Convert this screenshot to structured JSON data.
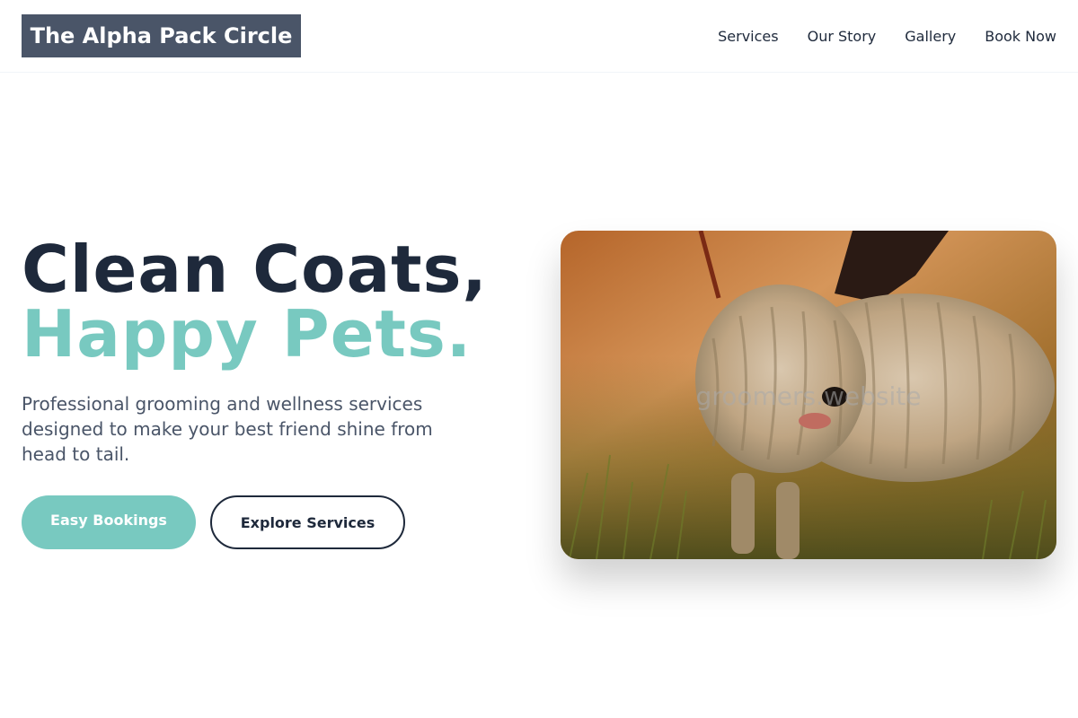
{
  "header": {
    "logo_text": "The Alpha Pack Circle",
    "nav": [
      "Services",
      "Our Story",
      "Gallery",
      "Book Now"
    ]
  },
  "hero": {
    "title_line1": "Clean Coats,",
    "title_line2": "Happy Pets.",
    "description": "Professional grooming and wellness services designed to make your best friend shine from head to tail.",
    "primary_button": "Easy Bookings",
    "secondary_button": "Explore Services",
    "image_watermark": "groomers.website"
  },
  "colors": {
    "brand_dark": "#1e293b",
    "accent_teal": "#78c9c0",
    "logo_bg": "#4a5568"
  }
}
